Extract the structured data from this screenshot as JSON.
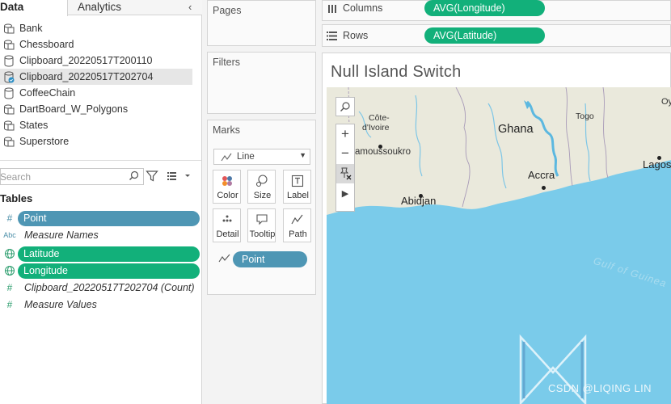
{
  "data_pane": {
    "tabs": [
      "Data",
      "Analytics"
    ],
    "collapse_icon": "chevron-left-icon",
    "data_sources": [
      {
        "label": "Bank",
        "selected": false
      },
      {
        "label": "Chessboard",
        "selected": false
      },
      {
        "label": "Clipboard_20220517T200110",
        "selected": false
      },
      {
        "label": "Clipboard_20220517T202704",
        "selected": true
      },
      {
        "label": "CoffeeChain",
        "selected": false
      },
      {
        "label": "DartBoard_W_Polygons",
        "selected": false
      },
      {
        "label": "States",
        "selected": false
      },
      {
        "label": "Superstore",
        "selected": false
      }
    ],
    "search": {
      "placeholder": "Search"
    },
    "tables_heading": "Tables",
    "fields": [
      {
        "type_icon": "#",
        "label": "Point",
        "style": "pill-blue"
      },
      {
        "type_icon": "Abc",
        "label": "Measure Names",
        "style": "italic"
      },
      {
        "type_icon": "globe",
        "label": "Latitude",
        "style": "pill-green"
      },
      {
        "type_icon": "globe",
        "label": "Longitude",
        "style": "pill-green"
      },
      {
        "type_icon": "#",
        "label": "Clipboard_20220517T202704 (Count)",
        "style": "italic"
      },
      {
        "type_icon": "#",
        "label": "Measure Values",
        "style": "italic"
      }
    ]
  },
  "cards": {
    "pages": "Pages",
    "filters": "Filters",
    "marks": {
      "title": "Marks",
      "mark_type": "Line",
      "buttons": [
        "Color",
        "Size",
        "Label",
        "Detail",
        "Tooltip",
        "Path"
      ],
      "path_pill": "Point"
    }
  },
  "shelves": {
    "columns": {
      "label": "Columns",
      "pill": "AVG(Longitude)"
    },
    "rows": {
      "label": "Rows",
      "pill": "AVG(Latitude)"
    }
  },
  "view": {
    "title": "Null Island Switch",
    "map_labels": {
      "cote": "Côte-",
      "divoire": "d'Ivoire",
      "yamoussoukro": "amoussoukro",
      "ghana": "Ghana",
      "togo": "Togo",
      "accra": "Accra",
      "abidjan": "Abidjan",
      "lagos": "Lagos",
      "oy": "Oy",
      "gulf": "Gulf of Guinea"
    },
    "watermark": "CSDN @LIQING LIN"
  },
  "colors": {
    "measure_pill": "#12b07a",
    "dimension_pill": "#4e96b4",
    "ocean": "#7acbea",
    "land": "#eae9dc"
  }
}
